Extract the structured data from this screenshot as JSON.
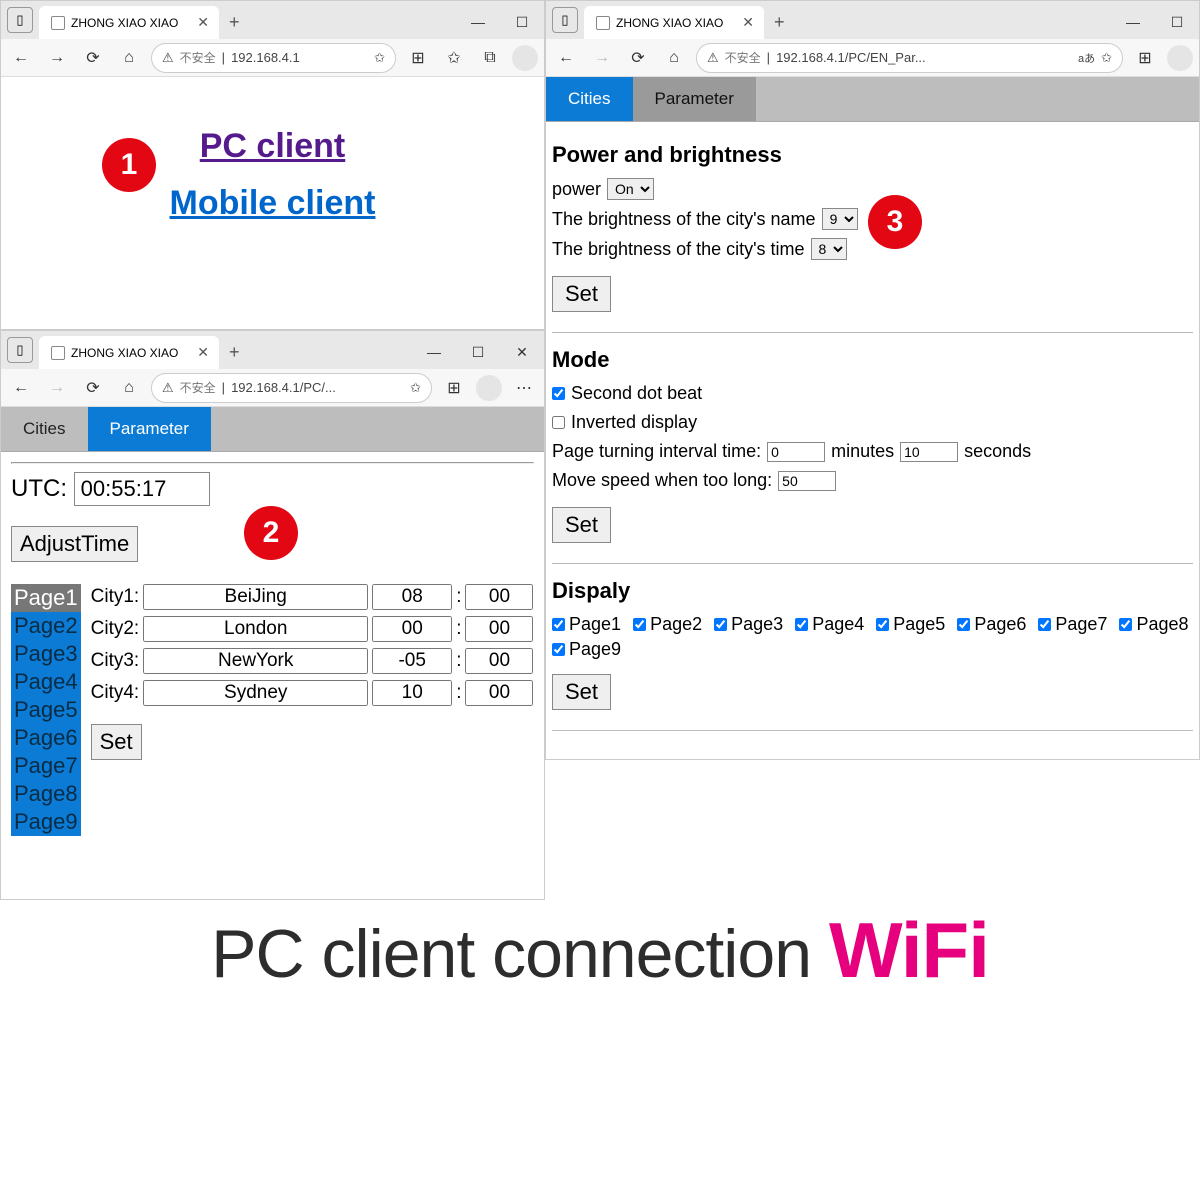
{
  "browser": {
    "tab_title": "ZHONG XIAO XIAO",
    "security_label": "不安全",
    "url1": "192.168.4.1",
    "url2": "192.168.4.1/PC/...",
    "url3": "192.168.4.1/PC/EN_Par...",
    "lang_badge": "aあ"
  },
  "panel1": {
    "pc_link": "PC client",
    "mobile_link": "Mobile client"
  },
  "panel2": {
    "tabs": {
      "cities": "Cities",
      "parameter": "Parameter"
    },
    "utc_label": "UTC:",
    "utc_value": "00:55:17",
    "adjust_btn": "AdjustTime",
    "pages": [
      "Page1",
      "Page2",
      "Page3",
      "Page4",
      "Page5",
      "Page6",
      "Page7",
      "Page8",
      "Page9"
    ],
    "cities": [
      {
        "label": "City1:",
        "name": "BeiJing",
        "tz": "08",
        "min": "00"
      },
      {
        "label": "City2:",
        "name": "London",
        "tz": "00",
        "min": "00"
      },
      {
        "label": "City3:",
        "name": "NewYork",
        "tz": "-05",
        "min": "00"
      },
      {
        "label": "City4:",
        "name": "Sydney",
        "tz": "10",
        "min": "00"
      }
    ],
    "set_btn": "Set"
  },
  "panel3": {
    "tabs": {
      "cities": "Cities",
      "parameter": "Parameter"
    },
    "power_h": "Power and brightness",
    "power_label": "power",
    "power_value": "On",
    "bright_name_label": "The brightness of the city's name",
    "bright_name_value": "9",
    "bright_time_label": "The brightness of the city's time",
    "bright_time_value": "8",
    "set_btn": "Set",
    "mode_h": "Mode",
    "second_dot": "Second dot beat",
    "inverted": "Inverted display",
    "interval_label_a": "Page turning interval time:",
    "interval_min": "0",
    "interval_label_b": "minutes",
    "interval_sec": "10",
    "interval_label_c": "seconds",
    "speed_label": "Move speed when too long:",
    "speed_value": "50",
    "display_h": "Dispaly",
    "display_pages": [
      "Page1",
      "Page2",
      "Page3",
      "Page4",
      "Page5",
      "Page6",
      "Page7",
      "Page8",
      "Page9"
    ]
  },
  "badges": {
    "b1": "1",
    "b2": "2",
    "b3": "3"
  },
  "caption": {
    "a": "PC client connection ",
    "b": "WiFi"
  }
}
